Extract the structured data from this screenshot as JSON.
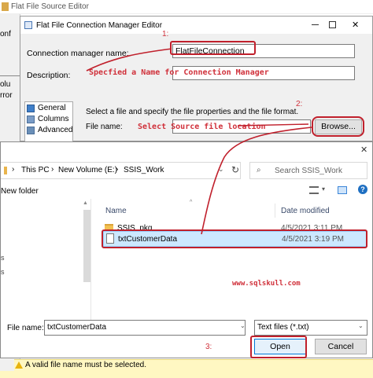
{
  "outer_window": {
    "title": "Flat File Source Editor",
    "left_labels": [
      "onf",
      "olu",
      "rror"
    ]
  },
  "cm_editor": {
    "title": "Flat File Connection Manager Editor",
    "close_glyph": "✕",
    "conn_name_label": "Connection manager name:",
    "conn_name_value": "FlatFileConnection",
    "description_label": "Description:",
    "nav_items": [
      {
        "label": "General",
        "icon": "general-icon"
      },
      {
        "label": "Columns",
        "icon": "columns-icon"
      },
      {
        "label": "Advanced",
        "icon": "advanced-icon"
      }
    ],
    "instruction": "Select a file and specify the file properties and the file format.",
    "file_name_label": "File name:",
    "browse_label": "Browse..."
  },
  "annotations": {
    "num1": "1:",
    "num2": "2:",
    "num3": "3:",
    "spec_name": "Specfied a Name for Connection Manager",
    "select_location": "Select Source file location",
    "watermark": "www.sqlskull.com"
  },
  "open_dialog": {
    "close_glyph": "✕",
    "breadcrumb": [
      "This PC",
      "New Volume (E:)",
      "SSIS_Work"
    ],
    "search_placeholder": "Search SSIS_Work",
    "new_folder_label": "New folder",
    "col_name": "Name",
    "col_date": "Date modified",
    "files": [
      {
        "name": "SSIS_pkg",
        "date": "4/5/2021 3:11 PM",
        "icon": "folder-icon",
        "selected": false
      },
      {
        "name": "txtCustomerData",
        "date": "4/5/2021 3:19 PM",
        "icon": "text-file-icon",
        "selected": true
      }
    ],
    "left_pane_marks": [
      "s",
      "s"
    ],
    "file_name_label": "File name:",
    "file_name_value": "txtCustomerData",
    "file_type_value": "Text files (*.txt)",
    "open_label": "Open",
    "cancel_label": "Cancel"
  },
  "warning": {
    "text": "A valid file name must be selected."
  }
}
